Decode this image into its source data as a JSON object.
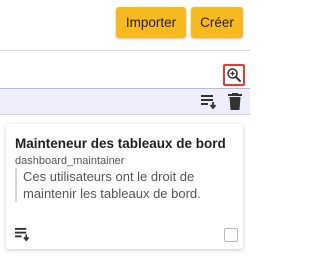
{
  "toolbar": {
    "import_label": "Importer",
    "create_label": "Créer"
  },
  "search": {
    "zoom_icon": "zoom-in-icon"
  },
  "actions": {
    "export_icon": "export-list-icon",
    "delete_icon": "trash-icon"
  },
  "card": {
    "title": "Mainteneur des tableaux de bord",
    "subtitle": "dashboard_maintainer",
    "description": "Ces utilisateurs ont le droit de maintenir les tableaux de bord.",
    "export_icon": "export-list-icon",
    "checked": false
  },
  "colors": {
    "accent": "#f6b91e",
    "highlight": "#e53935",
    "action_bar": "#eeeefb"
  }
}
